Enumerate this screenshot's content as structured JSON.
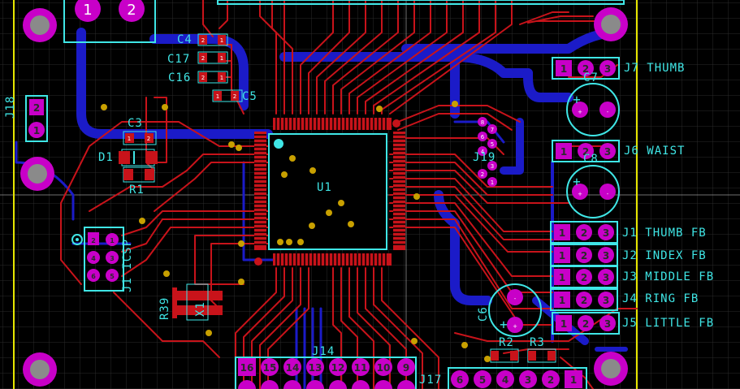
{
  "board": {
    "colors": {
      "background": "#000000",
      "grid": "#303030",
      "top_copper": "#c8131a",
      "bottom_copper": "#1b1bc8",
      "silkscreen": "#3fe6e6",
      "pad": "#c800c8",
      "board_edge": "#e6e600",
      "mounting_hole": "#c800c8"
    },
    "labels": {
      "c4": "C4",
      "c17": "C17",
      "c16": "C16",
      "c5": "C5",
      "c3": "C3",
      "d1": "D1",
      "r1": "R1",
      "j18": "J18",
      "j1_icsp": "J1 ICSP",
      "r39": "R39",
      "x1": "X1",
      "u1": "U1",
      "j19": "J19",
      "j14": "J14",
      "j17": "J17",
      "c7": "C7",
      "c8": "C8",
      "c6": "C6",
      "r2": "R2",
      "r3": "R3",
      "j7": "J7 THUMB",
      "j6": "J6 WAIST",
      "j1fb": "J1 THUMB FB",
      "j2fb": "J2 INDEX FB",
      "j3fb": "J3 MIDDLE FB",
      "j4fb": "J4 RING FB",
      "j5fb": "J5 LITTLE FB"
    },
    "pads": {
      "top_connector": [
        "1",
        "2"
      ],
      "j18": [
        "2",
        "1"
      ],
      "header3": [
        "1",
        "2",
        "3"
      ],
      "icsp": [
        "2",
        "1",
        "4",
        "3",
        "6",
        "5"
      ],
      "j14_top": [
        "16",
        "15",
        "14",
        "13",
        "12",
        "11",
        "10",
        "9"
      ],
      "j17": [
        "6",
        "5",
        "4",
        "3",
        "2",
        "1"
      ],
      "j19": [
        "8",
        "7",
        "6",
        "5",
        "4",
        "3",
        "2",
        "1"
      ],
      "two_pin": [
        "1",
        "2"
      ]
    },
    "polarity": [
      "+",
      "-"
    ]
  }
}
